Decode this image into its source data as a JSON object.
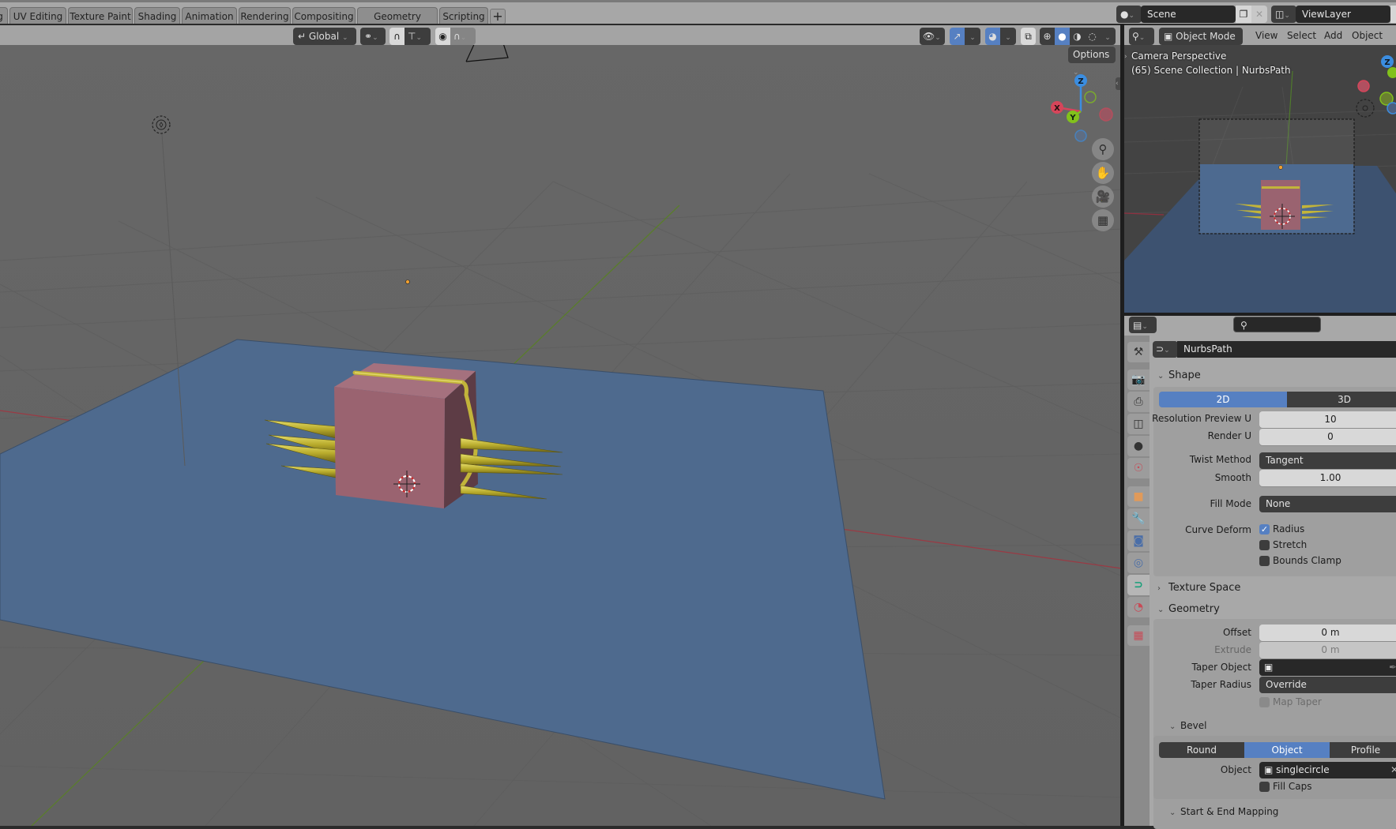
{
  "workspaces": {
    "partial_first_tab": "g",
    "tabs": [
      "UV Editing",
      "Texture Paint",
      "Shading",
      "Animation",
      "Rendering",
      "Compositing",
      "Geometry Nodes",
      "Scripting"
    ],
    "add_label": "+"
  },
  "scene_selector": {
    "icon": "scene-icon",
    "value": "Scene"
  },
  "view_layer_selector": {
    "icon": "render-layers-icon",
    "value": "ViewLayer"
  },
  "viewport_header": {
    "transform_orientation": "Global",
    "pivot_icon": "pivot-point-icon",
    "snap_icon": "magnet-icon",
    "snap_target_icon": "snap-increment-icon",
    "proportional_icon": "proportional-edit-icon",
    "falloff_icon": "falloff-curve-icon",
    "options_label": "Options",
    "visibility_icon": "eye-icon",
    "gizmo_icon": "gizmo-icon",
    "overlay_icon": "overlays-icon",
    "xray_icon": "xray-icon",
    "shading_modes": [
      "wireframe",
      "solid",
      "material",
      "rendered"
    ],
    "active_shading": "solid"
  },
  "navigation_gizmo": {
    "axes": [
      "X",
      "Y",
      "Z"
    ],
    "colors": {
      "x": "#d6455a",
      "y": "#82c11b",
      "z": "#3b8de0"
    },
    "buttons": [
      "zoom-icon",
      "hand-pan-icon",
      "camera-icon",
      "grid-ortho-icon"
    ]
  },
  "camera_view": {
    "header": {
      "editor_icon": "view3d-icon",
      "mode": "Object Mode",
      "menus": [
        "View",
        "Select",
        "Add",
        "Object"
      ]
    },
    "overlay_line1": "Camera Perspective",
    "overlay_line2": "(65) Scene Collection | NurbsPath"
  },
  "properties": {
    "search_placeholder": "",
    "datablock": "NurbsPath",
    "tabs": [
      {
        "name": "tool",
        "icon": "tool-icon"
      },
      {
        "name": "render",
        "icon": "render-icon"
      },
      {
        "name": "output",
        "icon": "output-icon"
      },
      {
        "name": "view-layer",
        "icon": "view-layer-icon"
      },
      {
        "name": "scene",
        "icon": "scene-icon"
      },
      {
        "name": "world",
        "icon": "world-icon"
      },
      {
        "name": "object",
        "icon": "object-icon"
      },
      {
        "name": "modifiers",
        "icon": "wrench-icon"
      },
      {
        "name": "particles",
        "icon": "particles-icon"
      },
      {
        "name": "physics",
        "icon": "physics-icon"
      },
      {
        "name": "curve-data",
        "icon": "curve-icon",
        "active": true
      },
      {
        "name": "material",
        "icon": "material-icon"
      },
      {
        "name": "texture",
        "icon": "texture-icon"
      }
    ],
    "shape": {
      "title": "Shape",
      "dim_options": [
        "2D",
        "3D"
      ],
      "dim_selected": "2D",
      "resolution_preview_label": "Resolution Preview U",
      "resolution_preview_value": "10",
      "render_u_label": "Render U",
      "render_u_value": "0",
      "twist_method_label": "Twist Method",
      "twist_method_value": "Tangent",
      "smooth_label": "Smooth",
      "smooth_value": "1.00",
      "fill_mode_label": "Fill Mode",
      "fill_mode_value": "None",
      "curve_deform_label": "Curve Deform",
      "radius_label": "Radius",
      "radius_checked": true,
      "stretch_label": "Stretch",
      "stretch_checked": false,
      "bounds_clamp_label": "Bounds Clamp",
      "bounds_clamp_checked": false
    },
    "texture_space": {
      "title": "Texture Space",
      "expanded": false
    },
    "geometry": {
      "title": "Geometry",
      "offset_label": "Offset",
      "offset_value": "0 m",
      "extrude_label": "Extrude",
      "extrude_value": "0 m",
      "taper_object_label": "Taper Object",
      "taper_object_value": "",
      "taper_radius_label": "Taper Radius",
      "taper_radius_value": "Override",
      "map_taper_label": "Map Taper",
      "map_taper_checked": false
    },
    "bevel": {
      "title": "Bevel",
      "modes": [
        "Round",
        "Object",
        "Profile"
      ],
      "mode_selected": "Object",
      "object_label": "Object",
      "object_value": "singlecircle",
      "fill_caps_label": "Fill Caps",
      "fill_caps_checked": false
    },
    "start_end_mapping": {
      "title": "Start & End Mapping"
    }
  }
}
